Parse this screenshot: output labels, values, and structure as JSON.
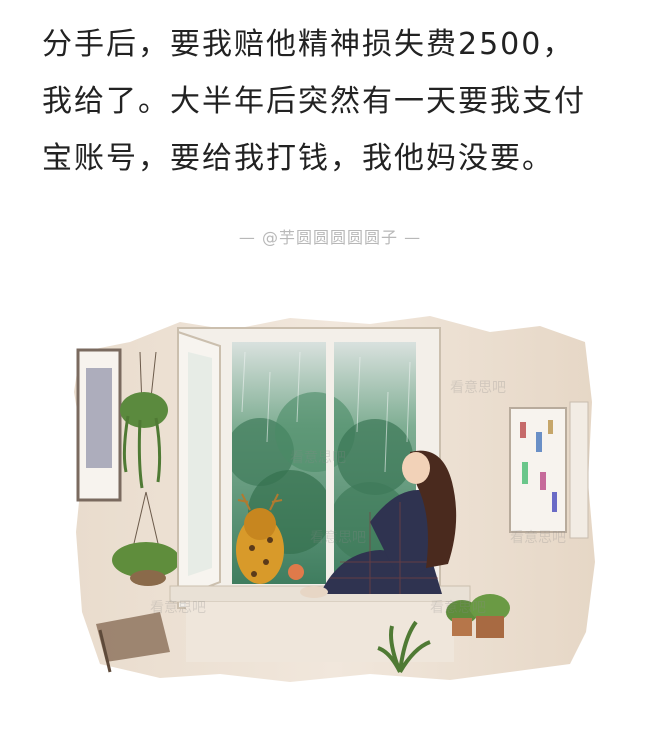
{
  "post": {
    "lines": [
      "分手后，要我赔他精神损失费2500，",
      "我给了。大半年后突然有一天要我支付",
      "宝账号，要给我打钱，我他妈没要。"
    ]
  },
  "credit": "— @芋圆圆圆圆圆子 —",
  "illustration": {
    "watermark": "看意思吧",
    "colors": {
      "wall": "#efe3d6",
      "window_frame": "#f3efe9",
      "rain_greenery": "#4f8a6b",
      "sky": "#cfdad6",
      "dress": "#2f3350",
      "hair": "#4a2a1e",
      "dog": "#d89a2a"
    }
  }
}
